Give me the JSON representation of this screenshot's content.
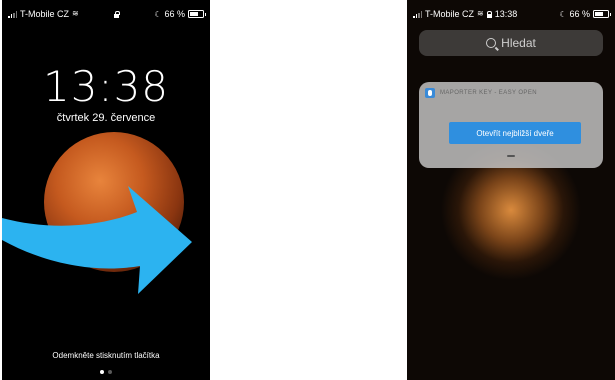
{
  "left_screen": {
    "status": {
      "carrier": "T-Mobile CZ",
      "battery": "66 %",
      "battery_level": 0.66
    },
    "time": "13:38",
    "date": "čtvrtek 29. července",
    "unlock_hint": "Odemkněte stisknutím tlačítka",
    "page_dots": 2,
    "colors": {
      "arrow": "#2cb3f0",
      "planet": "#c55a1f"
    }
  },
  "right_screen": {
    "status": {
      "carrier": "T-Mobile CZ",
      "time": "13:38",
      "battery": "66 %",
      "battery_level": 0.66
    },
    "search": {
      "placeholder": "Hledat"
    },
    "notification": {
      "app_name": "MAPORTER KEY - EASY OPEN",
      "action_label": "Otevřít nejbližší dveře"
    },
    "colors": {
      "accent": "#2f8fdf"
    }
  },
  "icons": [
    "signal-icon",
    "wifi-icon",
    "lock-icon",
    "moon-icon",
    "battery-icon",
    "search-icon",
    "app-icon",
    "arrow-icon"
  ]
}
